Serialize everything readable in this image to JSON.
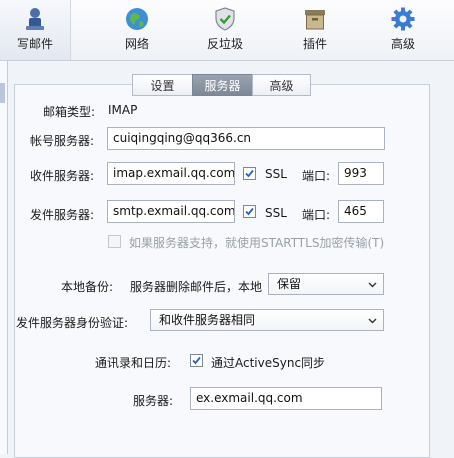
{
  "toolbar": {
    "items": [
      {
        "label": "写邮件",
        "icon": "compose-icon"
      },
      {
        "label": "网络",
        "icon": "globe-icon"
      },
      {
        "label": "反垃圾",
        "icon": "shield-check-icon"
      },
      {
        "label": "插件",
        "icon": "plugin-box-icon"
      },
      {
        "label": "高级",
        "icon": "gear-icon"
      }
    ]
  },
  "tabs": [
    {
      "label": "设置",
      "active": false
    },
    {
      "label": "服务器",
      "active": true
    },
    {
      "label": "高级",
      "active": false
    }
  ],
  "form": {
    "mailbox_type_label": "邮箱类型:",
    "mailbox_type_value": "IMAP",
    "account_server_label": "帐号服务器:",
    "account_server_value": "cuiqingqing@qq366.cn",
    "incoming_label": "收件服务器:",
    "incoming_value": "imap.exmail.qq.com",
    "incoming_ssl_label": "SSL",
    "incoming_ssl_checked": true,
    "incoming_port_label": "端口:",
    "incoming_port_value": "993",
    "outgoing_label": "发件服务器:",
    "outgoing_value": "smtp.exmail.qq.com",
    "outgoing_ssl_label": "SSL",
    "outgoing_ssl_checked": true,
    "outgoing_port_label": "端口:",
    "outgoing_port_value": "465",
    "starttls_label": "如果服务器支持，就使用STARTTLS加密传输(T)",
    "starttls_checked": false,
    "local_backup_label": "本地备份:",
    "local_backup_desc": "服务器删除邮件后，本地",
    "local_backup_selected": "保留",
    "smtp_auth_label": "发件服务器身份验证:",
    "smtp_auth_selected": "和收件服务器相同",
    "contacts_label": "通讯录和日历:",
    "activesync_label": "通过ActiveSync同步",
    "activesync_checked": true,
    "sync_server_label": "服务器:",
    "sync_server_value": "ex.exmail.qq.com"
  },
  "colors": {
    "accent_blue": "#2a63b8",
    "active_tab": "#8a93a0"
  }
}
